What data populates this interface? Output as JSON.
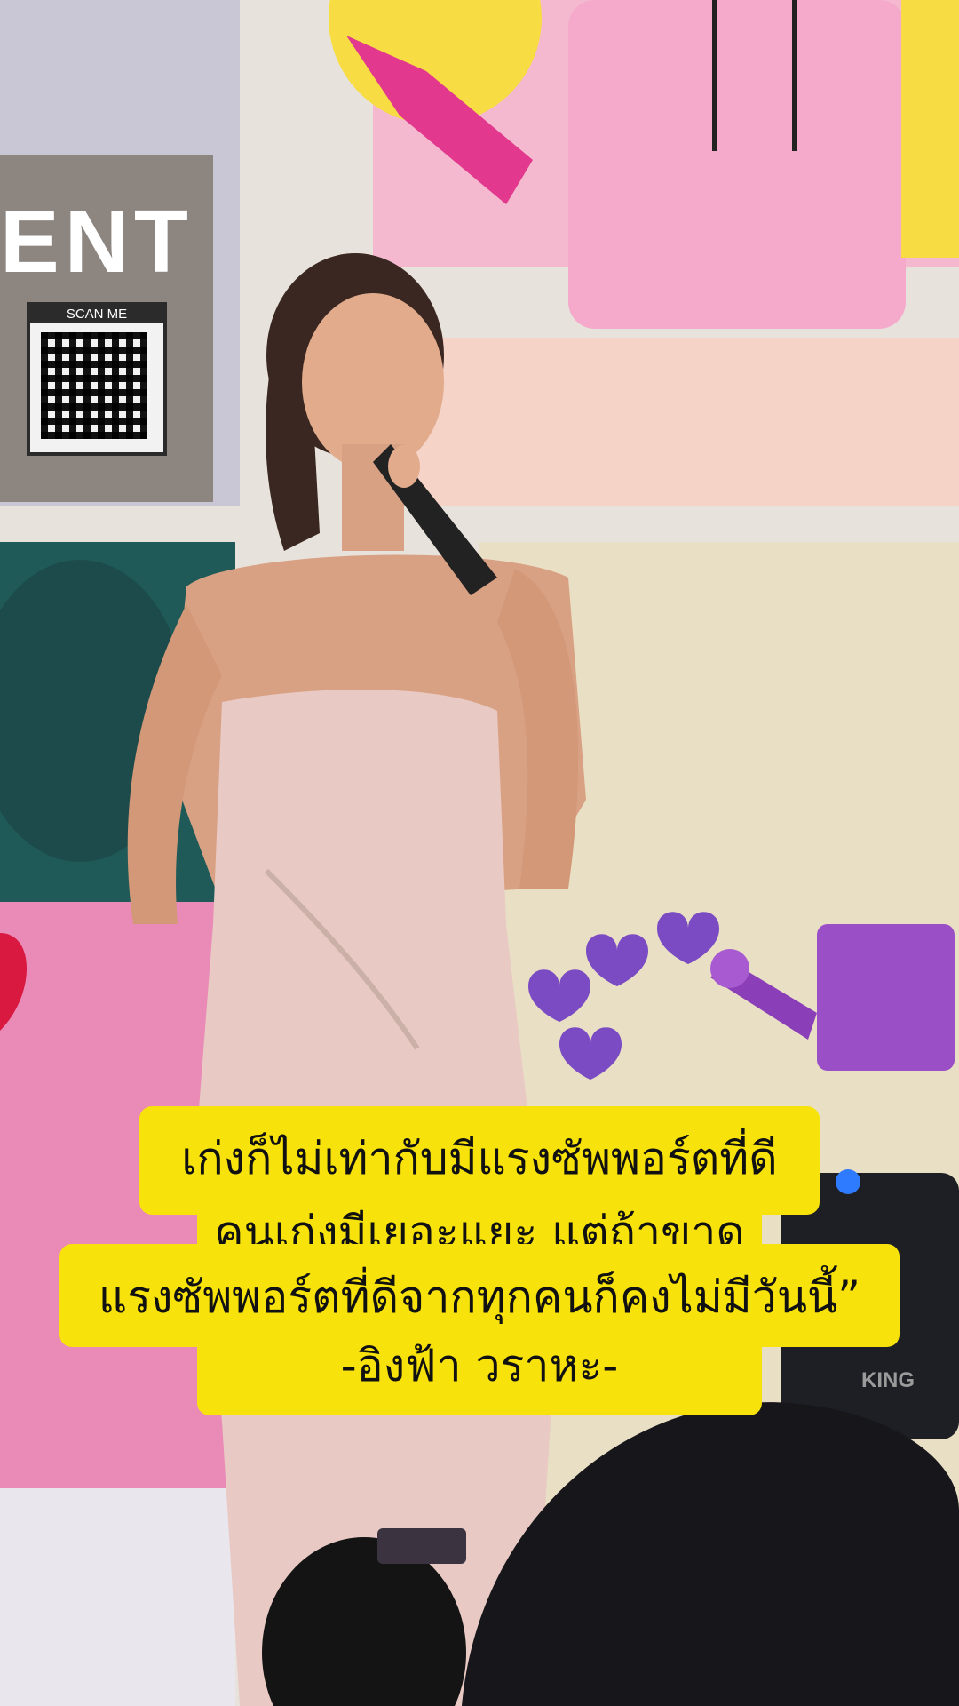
{
  "backdrop": {
    "sign_text": "ENT",
    "qr_label": "SCAN ME",
    "speaker_brand": "KING"
  },
  "caption": {
    "line1": "เก่งก็ไม่เท่ากับมีแรงซัพพอร์ตที่ดี",
    "line2": "คนเก่งมีเยอะแยะ แต่ถ้าขาด",
    "line3": "แรงซัพพอร์ตที่ดีจากทุกคนก็คงไม่มีวันนี้”",
    "line4": "-อิงฟ้า วราหะ-"
  },
  "colors": {
    "caption_bg": "#f7e20c",
    "caption_text": "#111111",
    "dress": "#e8c9c3",
    "heart_purple": "#7b4bc4"
  }
}
